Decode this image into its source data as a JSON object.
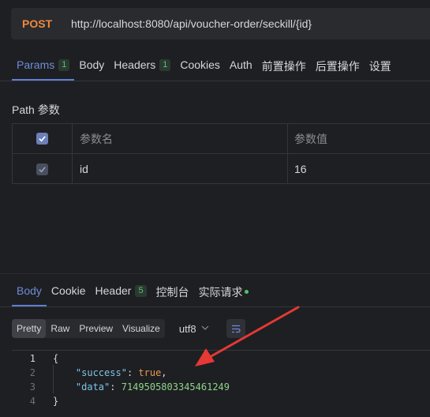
{
  "request": {
    "method": "POST",
    "url": "http://localhost:8080/api/voucher-order/seckill/{id}"
  },
  "request_tabs": [
    {
      "label": "Params",
      "badge": "1"
    },
    {
      "label": "Body",
      "badge": ""
    },
    {
      "label": "Headers",
      "badge": "1"
    },
    {
      "label": "Cookies",
      "badge": ""
    },
    {
      "label": "Auth",
      "badge": ""
    },
    {
      "label": "前置操作",
      "badge": ""
    },
    {
      "label": "后置操作",
      "badge": ""
    },
    {
      "label": "设置",
      "badge": ""
    }
  ],
  "path_section": {
    "title": "Path 参数",
    "header_name": "参数名",
    "header_value": "参数值",
    "row": {
      "name": "id",
      "value": "16"
    }
  },
  "response_tabs": [
    {
      "label": "Body",
      "badge": ""
    },
    {
      "label": "Cookie",
      "badge": ""
    },
    {
      "label": "Header",
      "badge": "5"
    },
    {
      "label": "控制台",
      "badge": ""
    },
    {
      "label": "实际请求",
      "badge": ""
    }
  ],
  "view_modes": [
    "Pretty",
    "Raw",
    "Preview",
    "Visualize"
  ],
  "encoding": "utf8",
  "code": {
    "line_numbers": [
      "1",
      "2",
      "3",
      "4"
    ],
    "open_brace": "{",
    "key1": "\"success\"",
    "val1": "true",
    "key2": "\"data\"",
    "val2": "7149505803345461249",
    "close_brace": "}"
  },
  "colors": {
    "accent": "#5e7ed3",
    "method": "#f0883e",
    "json_key": "#7fc4e8",
    "json_bool": "#e59a4e",
    "json_number": "#8dd48a",
    "arrow": "#e53935"
  }
}
